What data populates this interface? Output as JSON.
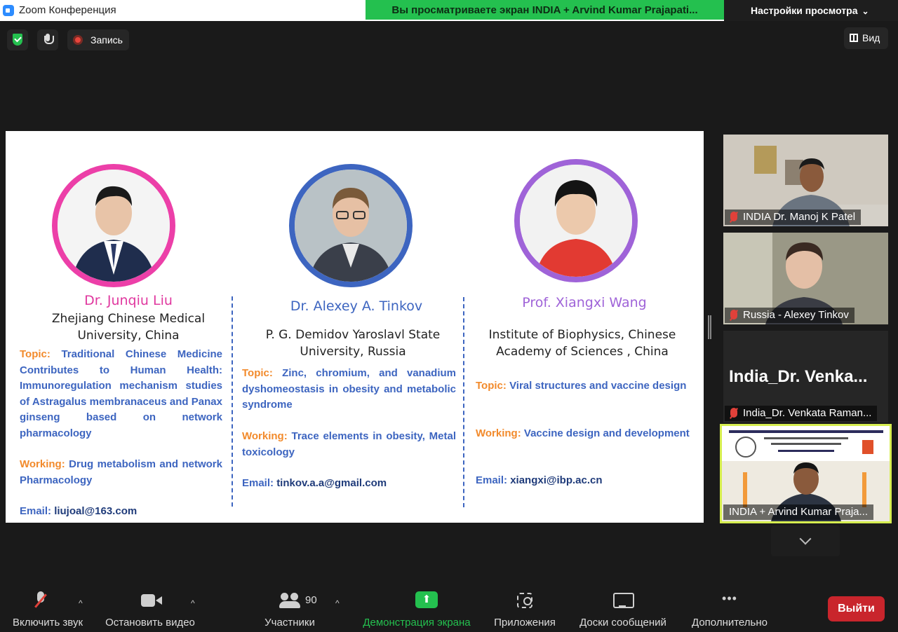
{
  "window": {
    "title": "Zoom Конференция"
  },
  "share_banner": "Вы просматриваете экран INDIA + Arvind Kumar Prajapati...",
  "view_settings": "Настройки просмотра",
  "top_controls": {
    "record_label": "Запись",
    "view_label": "Вид"
  },
  "slide": {
    "speakers": [
      {
        "name": "Dr. Junqiu Liu",
        "institution": "Zhejiang Chinese Medical University, China",
        "topic_label": "Topic:",
        "topic": "Traditional Chinese Medicine Contributes to Human Health: Immunoregulation mechanism studies of Astragalus membranaceus and Panax ginseng based on network pharmacology",
        "working_label": "Working:",
        "working": "Drug metabolism and network Pharmacology",
        "email_label": "Email:",
        "email": "liujoal@163.com"
      },
      {
        "name": "Dr. Alexey A. Tinkov",
        "institution": "P. G. Demidov Yaroslavl State University, Russia",
        "topic_label": "Topic:",
        "topic": "Zinc, chromium, and vanadium dyshomeostasis in obesity and metabolic syndrome",
        "working_label": "Working:",
        "working": "Trace elements in obesity, Metal toxicology",
        "email_label": "Email:",
        "email": "tinkov.a.a@gmail.com"
      },
      {
        "name": "Prof. Xiangxi Wang",
        "institution": "Institute of Biophysics, Chinese Academy of Sciences , China",
        "topic_label": "Topic:",
        "topic": "Viral structures and vaccine design",
        "working_label": "Working:",
        "working": "Vaccine design and development",
        "email_label": "Email:",
        "email": "xiangxi@ibp.ac.cn"
      }
    ]
  },
  "participants": [
    {
      "name": "INDIA Dr. Manoj K Patel",
      "muted": true
    },
    {
      "name": "Russia - Alexey Tinkov",
      "muted": true
    },
    {
      "name": "India_Dr. Venkata Raman...",
      "display": "India_Dr. Venka...",
      "muted": true
    },
    {
      "name": "INDIA + Arvind Kumar Praja...",
      "muted": false,
      "active_speaker": true
    }
  ],
  "toolbar": {
    "unmute": "Включить звук",
    "stop_video": "Остановить видео",
    "participants": "Участники",
    "participants_count": "90",
    "share_screen": "Демонстрация экрана",
    "apps": "Приложения",
    "whiteboards": "Доски сообщений",
    "more": "Дополнительно",
    "leave": "Выйти"
  },
  "colors": {
    "share_green": "#24c04f",
    "leave_red": "#c9252c",
    "active_border": "#d6ee4f"
  }
}
